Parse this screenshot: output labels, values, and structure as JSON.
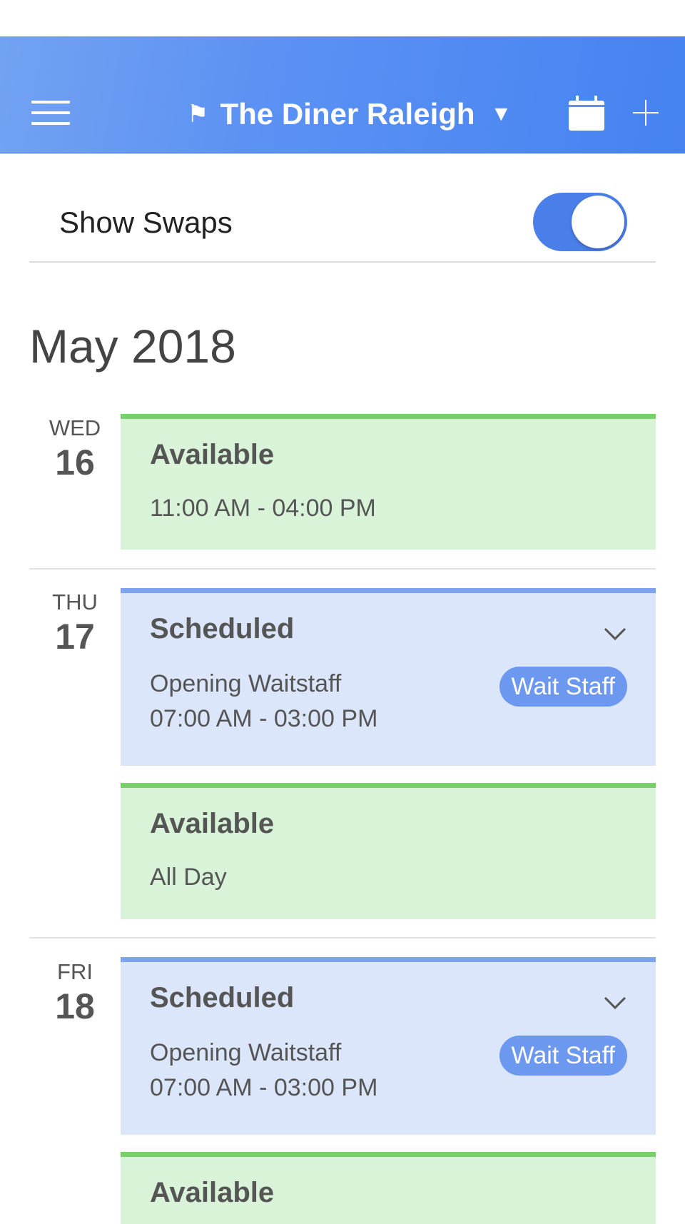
{
  "header": {
    "location_name": "The Diner Raleigh",
    "flag_icon": "⚑",
    "caret_icon": "▼",
    "gradient_colors": [
      "#73a2f2",
      "#4583f1"
    ]
  },
  "settings": {
    "show_swaps_label": "Show Swaps",
    "show_swaps_on": true,
    "toggle_color": "#4a7ee8"
  },
  "month_heading": "May 2018",
  "status_colors": {
    "available_bg": "#d8f3d8",
    "available_accent": "#78d06a",
    "scheduled_bg": "#dbe6fa",
    "scheduled_accent": "#7ea3ee",
    "badge_bg": "#6d98ef"
  },
  "days": [
    {
      "dow": "WED",
      "day": "16",
      "entries": [
        {
          "type": "available",
          "title": "Available",
          "time": "11:00 AM - 04:00 PM"
        }
      ]
    },
    {
      "dow": "THU",
      "day": "17",
      "entries": [
        {
          "type": "scheduled",
          "title": "Scheduled",
          "shift": "Opening Waitstaff",
          "time": "07:00 AM - 03:00 PM",
          "role": "Wait Staff"
        },
        {
          "type": "available",
          "title": "Available",
          "time": "All Day"
        }
      ]
    },
    {
      "dow": "FRI",
      "day": "18",
      "entries": [
        {
          "type": "scheduled",
          "title": "Scheduled",
          "shift": "Opening Waitstaff",
          "time": "07:00 AM - 03:00 PM",
          "role": "Wait Staff"
        },
        {
          "type": "available",
          "title": "Available"
        }
      ]
    }
  ]
}
